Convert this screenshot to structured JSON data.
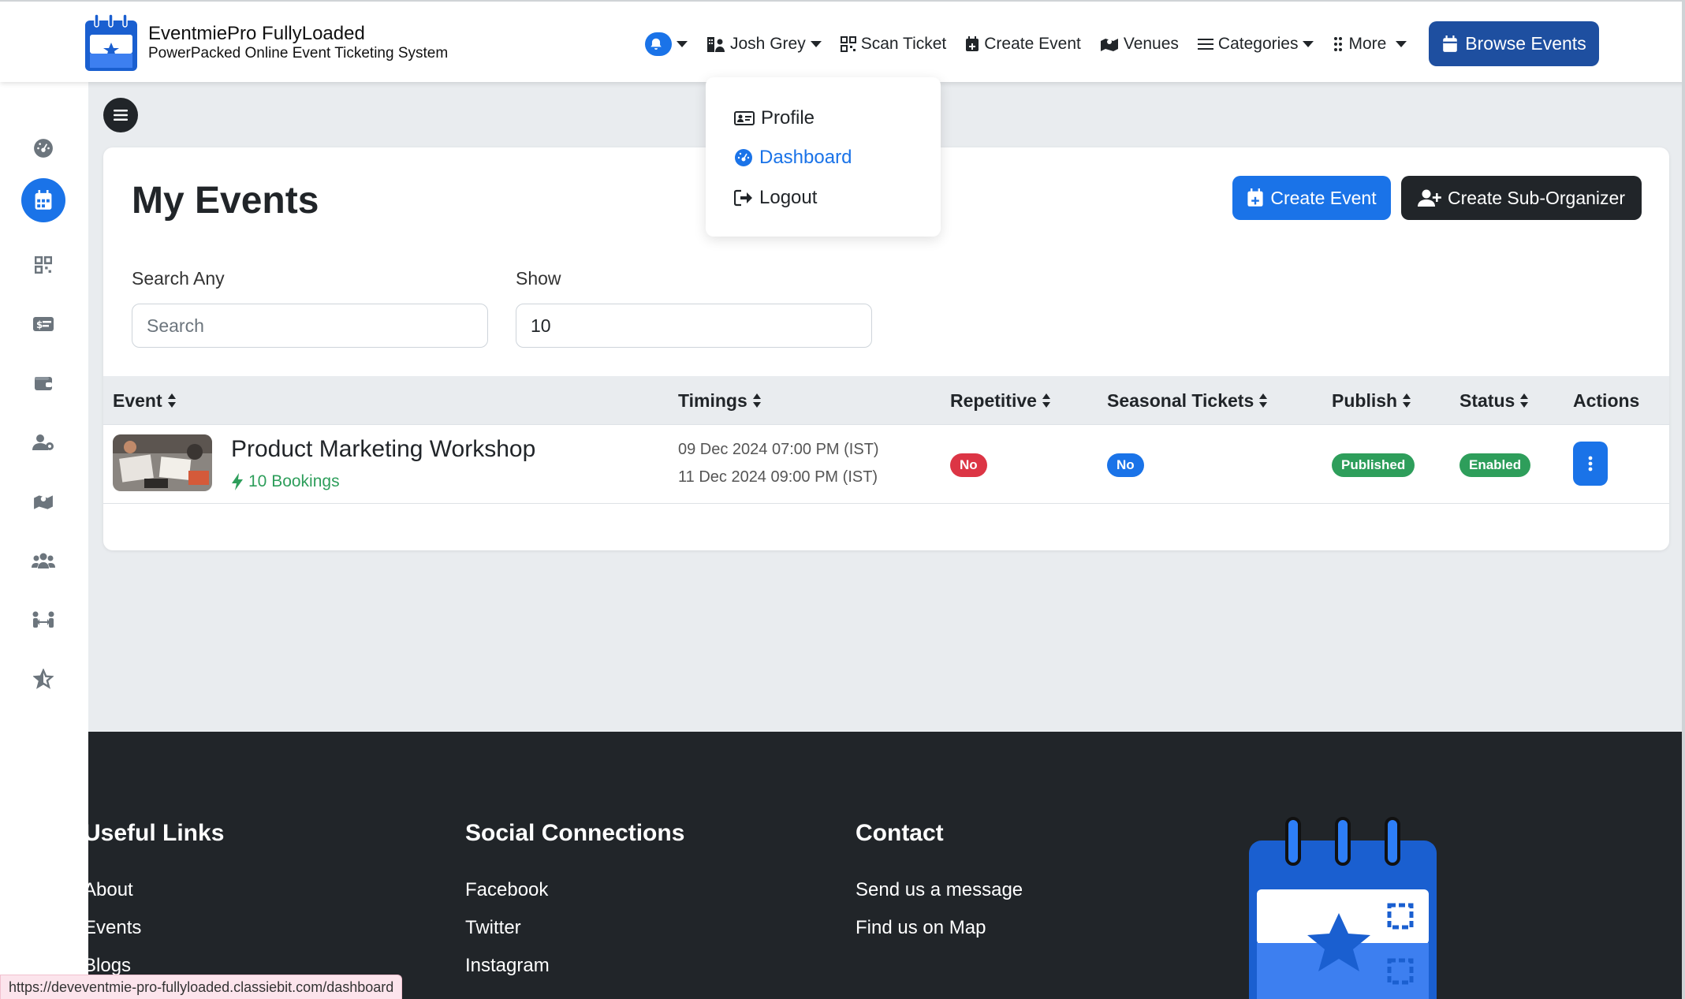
{
  "brand": {
    "title": "EventmiePro FullyLoaded",
    "subtitle": "PowerPacked Online Event Ticketing System"
  },
  "nav": {
    "user_name": "Josh Grey",
    "scan_ticket": "Scan Ticket",
    "create_event": "Create Event",
    "venues": "Venues",
    "categories": "Categories",
    "more": "More",
    "browse_events": "Browse Events"
  },
  "user_menu": {
    "items": [
      {
        "label": "Profile",
        "icon": "id-card-icon",
        "active": false
      },
      {
        "label": "Dashboard",
        "icon": "dashboard-icon",
        "active": true
      },
      {
        "label": "Logout",
        "icon": "logout-icon",
        "active": false
      }
    ]
  },
  "sidebar": {
    "items": [
      {
        "icon": "dashboard-icon",
        "active": false
      },
      {
        "icon": "calendar-icon",
        "active": true
      },
      {
        "icon": "qrcode-icon",
        "active": false
      },
      {
        "icon": "ticket-icon",
        "active": false
      },
      {
        "icon": "wallet-icon",
        "active": false
      },
      {
        "icon": "user-gear-icon",
        "active": false
      },
      {
        "icon": "map-icon",
        "active": false
      },
      {
        "icon": "users-icon",
        "active": false
      },
      {
        "icon": "people-arrows-icon",
        "active": false
      },
      {
        "icon": "star-icon",
        "active": false
      }
    ]
  },
  "page": {
    "title": "My Events",
    "create_event_button": "Create Event",
    "create_suborganizer_button": "Create Sub-Organizer",
    "search_label": "Search Any",
    "search_placeholder": "Search",
    "show_label": "Show",
    "show_value": "10"
  },
  "table": {
    "columns": [
      "Event",
      "Timings",
      "Repetitive",
      "Seasonal Tickets",
      "Publish",
      "Status",
      "Actions"
    ],
    "rows": [
      {
        "title": "Product Marketing Workshop",
        "bookings": "10 Bookings",
        "start": "09 Dec 2024 07:00 PM (IST)",
        "end": "11 Dec 2024 09:00 PM (IST)",
        "repetitive": "No",
        "seasonal": "No",
        "publish": "Published",
        "status": "Enabled"
      }
    ]
  },
  "footer": {
    "useful_links_heading": "Useful Links",
    "useful_links": [
      "About",
      "Events",
      "Blogs"
    ],
    "social_heading": "Social Connections",
    "social_links": [
      "Facebook",
      "Twitter",
      "Instagram"
    ],
    "contact_heading": "Contact",
    "contact_links": [
      "Send us a message",
      "Find us on Map"
    ]
  },
  "status_url": "https://deveventmie-pro-fullyloaded.classiebit.com/dashboard",
  "colors": {
    "primary": "#1a73e8",
    "dark": "#212529",
    "brand_navy": "#1e4fa0",
    "danger": "#dc3545",
    "success": "#2e9e5b"
  }
}
